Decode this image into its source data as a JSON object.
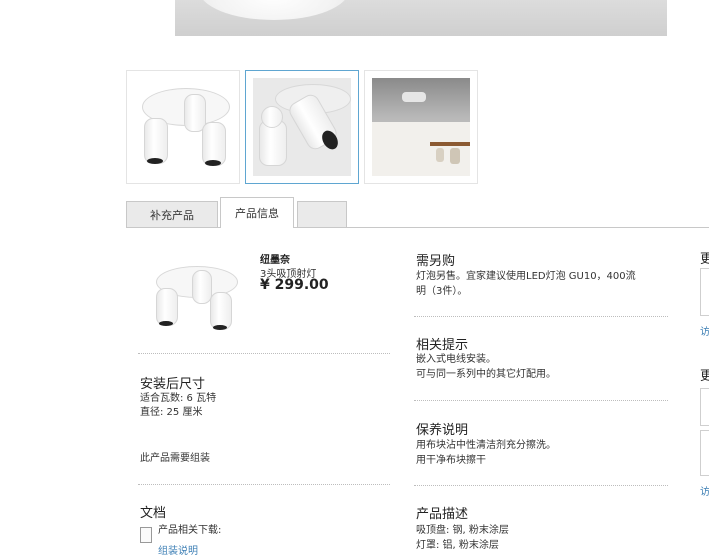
{
  "tabs": [
    {
      "label": "补充产品"
    },
    {
      "label": "产品信息"
    },
    {
      "label": ""
    }
  ],
  "product": {
    "name": "纽墨奈",
    "desc": "3头吸顶射灯",
    "price": "¥ 299.00"
  },
  "left": {
    "size_title": "安装后尺寸",
    "size_lines": [
      "适合瓦数: 6 瓦特",
      "直径: 25 厘米"
    ],
    "assembly": "此产品需要组装",
    "docs_title": "文档",
    "docs_label": "产品相关下载:",
    "docs_link": "组装说明"
  },
  "right": {
    "buy_title": "需另购",
    "buy_text_1": "灯泡另售。宜家建议使用LED灯泡 GU10，400流",
    "buy_text_2": "明（3件）。",
    "tips_title": "相关提示",
    "tips_lines": [
      "嵌入式电线安装。",
      "可与同一系列中的其它灯配用。"
    ],
    "care_title": "保养说明",
    "care_lines": [
      "用布块沾中性清洁剂充分擦洗。",
      "用干净布块擦干"
    ],
    "desc_title": "产品描述",
    "desc_lines": [
      "吸顶盘: 钢, 粉末涂层",
      "灯罩: 铝, 粉末涂层"
    ]
  },
  "edge": {
    "char_top": "更",
    "link_top": "访",
    "char_mid": "更",
    "link_bottom": "访"
  }
}
